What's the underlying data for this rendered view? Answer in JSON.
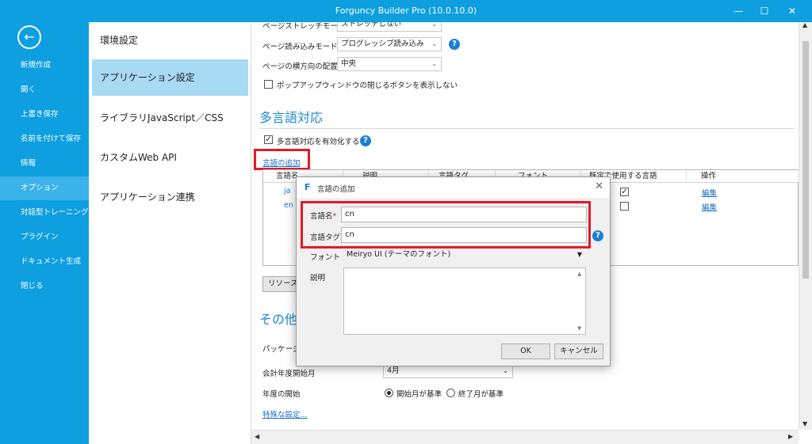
{
  "window": {
    "title": "Forguncy Builder Pro (10.0.10.0)",
    "minimize_glyph": "—",
    "maximize_glyph": "☐",
    "close_glyph": "✕"
  },
  "leftnav": {
    "back_icon": "←",
    "items": [
      {
        "label": "新規作成"
      },
      {
        "label": "開く"
      },
      {
        "label": "上書き保存"
      },
      {
        "label": "名前を付けて保存"
      },
      {
        "label": "情報"
      },
      {
        "label": "オプション",
        "active": true
      },
      {
        "label": "対話型トレーニング"
      },
      {
        "label": "プラグイン"
      },
      {
        "label": "ドキュメント生成"
      },
      {
        "label": "閉じる"
      }
    ]
  },
  "settingsnav": {
    "items": [
      {
        "label": "環境設定"
      },
      {
        "label": "アプリケーション設定",
        "active": true
      },
      {
        "label": "ライブラリJavaScript／CSS"
      },
      {
        "label": "カスタムWeb API"
      },
      {
        "label": "アプリケーション連携"
      }
    ]
  },
  "content": {
    "stretch_label": "ページストレッチモード",
    "stretch_value": "ストレッチしない",
    "load_label": "ページ読み込みモード",
    "load_value": "プログレッシブ読み込み",
    "align_label": "ページの横方向の配置",
    "align_value": "中央",
    "popup_close_label": "ポップアップウィンドウの閉じるボタンを表示しない",
    "multilang_heading": "多言語対応",
    "enable_multilang_label": "多言語対応を有効化する",
    "add_lang_link": "言語の追加",
    "table": {
      "headers": [
        "言語名",
        "説明",
        "言語タグ",
        "フォント",
        "既定で使用する言語",
        "操作"
      ],
      "rows": [
        {
          "name": "ja",
          "default_check": "✓",
          "action": "編集"
        },
        {
          "name": "en",
          "default_check": "",
          "action": "編集"
        }
      ]
    },
    "resource_button": "リソースマネージャー",
    "other_heading": "その他",
    "package_label": "パッケージファイル",
    "fiscal_label": "会計年度開始月",
    "fiscal_value": "4月",
    "year_start_label": "年度の開始",
    "radio_start_label": "開始月が基準",
    "radio_end_label": "終了月が基準",
    "special_link": "特殊な設定..."
  },
  "dialog": {
    "logo": "F",
    "title": "言語の追加",
    "close_glyph": "✕",
    "lang_name_label": "言語名",
    "required_mark": "*",
    "lang_name_value": "cn",
    "lang_tag_label": "言語タグ",
    "lang_tag_value": "cn",
    "font_label": "フォント",
    "font_value": "Meiryo UI (テーマのフォント)",
    "desc_label": "説明",
    "ok_label": "OK",
    "cancel_label": "キャンセル"
  },
  "help_glyph": "?",
  "colors": {
    "accent": "#0e9fe0",
    "nav_active": "#3bb3ea",
    "settings_active": "#a8daf3",
    "heading": "#1a8ad4",
    "highlight": "#e01b24"
  }
}
